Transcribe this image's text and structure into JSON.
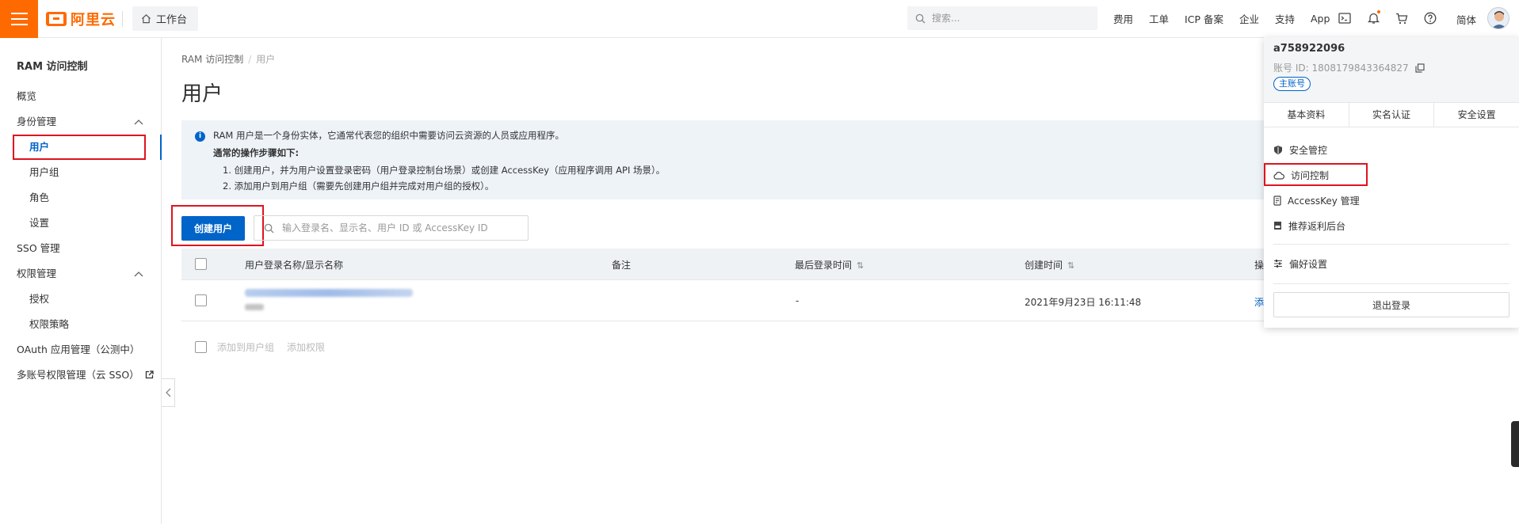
{
  "header": {
    "logo_text": "阿里云",
    "workbench_label": "工作台",
    "search_placeholder": "搜索...",
    "links": [
      "费用",
      "工单",
      "ICP 备案",
      "企业",
      "支持",
      "App"
    ],
    "lang": "简体",
    "accent_color": "#ff6a00"
  },
  "sidebar": {
    "title": "RAM 访问控制",
    "items": [
      {
        "label": "概览",
        "level": 1
      },
      {
        "label": "身份管理",
        "level": 1,
        "expanded": true
      },
      {
        "label": "用户",
        "level": 2,
        "active": true
      },
      {
        "label": "用户组",
        "level": 2
      },
      {
        "label": "角色",
        "level": 2
      },
      {
        "label": "设置",
        "level": 2
      },
      {
        "label": "SSO 管理",
        "level": 1
      },
      {
        "label": "权限管理",
        "level": 1,
        "expanded": true
      },
      {
        "label": "授权",
        "level": 2
      },
      {
        "label": "权限策略",
        "level": 2
      },
      {
        "label": "OAuth 应用管理（公测中）",
        "level": 1
      },
      {
        "label": "多账号权限管理（云 SSO）",
        "level": 1,
        "external": true
      }
    ]
  },
  "main": {
    "breadcrumb": [
      "RAM 访问控制",
      "用户"
    ],
    "title": "用户",
    "notice": {
      "intro": "RAM 用户是一个身份实体，它通常代表您的组织中需要访问云资源的人员或应用程序。",
      "steps_title": "通常的操作步骤如下:",
      "step1": "1. 创建用户，并为用户设置登录密码（用户登录控制台场景）或创建 AccessKey（应用程序调用 API 场景）。",
      "step2": "2. 添加用户到用户组（需要先创建用户组并完成对用户组的授权）。"
    },
    "create_button": "创建用户",
    "search_placeholder": "输入登录名、显示名、用户 ID 或 AccessKey ID",
    "table": {
      "columns": [
        "用户登录名称/显示名称",
        "备注",
        "最后登录时间",
        "创建时间",
        "操"
      ],
      "rows": [
        {
          "last_login": "-",
          "created": "2021年9月23日 16:11:48",
          "op": "添"
        }
      ]
    },
    "batch_actions": [
      "添加到用户组",
      "添加权限"
    ]
  },
  "account_menu": {
    "name": "a758922096",
    "id_label": "账号 ID:",
    "id_value": "1808179843364827",
    "badge": "主账号",
    "tabs": [
      "基本资料",
      "实名认证",
      "安全设置"
    ],
    "items": [
      {
        "label": "安全管控",
        "icon": "shield-icon"
      },
      {
        "label": "访问控制",
        "icon": "cloud-icon"
      },
      {
        "label": "AccessKey 管理",
        "icon": "key-icon"
      },
      {
        "label": "推荐返利后台",
        "icon": "gift-icon"
      }
    ],
    "preference": "偏好设置",
    "logout": "退出登录"
  }
}
